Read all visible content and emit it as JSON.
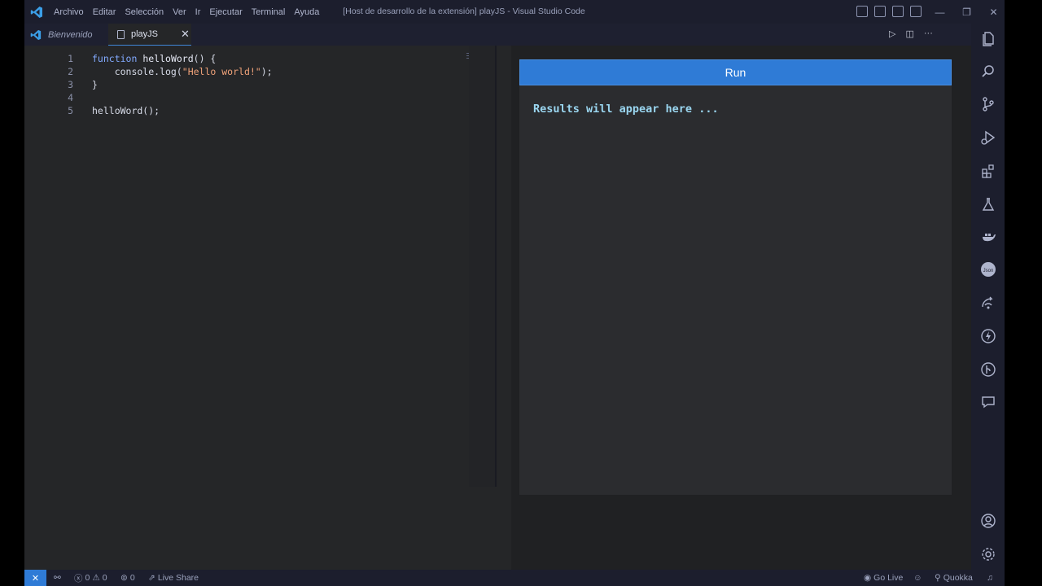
{
  "window": {
    "title": "[Host de desarrollo de la extensión] playJS - Visual Studio Code",
    "menu": [
      "Archivo",
      "Editar",
      "Selección",
      "Ver",
      "Ir",
      "Ejecutar",
      "Terminal",
      "Ayuda"
    ]
  },
  "tabs": [
    {
      "label": "Bienvenido",
      "active": false
    },
    {
      "label": "playJS",
      "active": true
    }
  ],
  "editor": {
    "lines": [
      {
        "n": "1",
        "parts": [
          {
            "t": "kw",
            "v": "function"
          },
          {
            "t": "plain",
            "v": " "
          },
          {
            "t": "fn",
            "v": "helloWord"
          },
          {
            "t": "plain",
            "v": "() {"
          }
        ]
      },
      {
        "n": "2",
        "parts": [
          {
            "t": "plain",
            "v": "    console.log("
          },
          {
            "t": "str",
            "v": "\"Hello world!\""
          },
          {
            "t": "plain",
            "v": ");"
          }
        ]
      },
      {
        "n": "3",
        "parts": [
          {
            "t": "plain",
            "v": "}"
          }
        ]
      },
      {
        "n": "4",
        "parts": []
      },
      {
        "n": "5",
        "parts": [
          {
            "t": "plain",
            "v": "helloWord();"
          }
        ]
      }
    ]
  },
  "webview": {
    "run_label": "Run",
    "results_text": "Results will appear here ..."
  },
  "activity_bar": [
    "explorer-icon",
    "search-icon",
    "source-control-icon",
    "run-debug-icon",
    "extensions-icon",
    "testing-icon",
    "docker-icon",
    "json-icon",
    "remote-icon",
    "thunder-client-icon",
    "git-graph-icon",
    "comments-icon",
    "account-icon",
    "settings-gear-icon"
  ],
  "status": {
    "errors": "0",
    "warnings": "0",
    "ports": "0",
    "live_share": "Live Share",
    "go_live": "Go Live",
    "quokka": "Quokka"
  },
  "colors": {
    "accent": "#2f7bd6",
    "results_text": "#9ad6f0"
  }
}
